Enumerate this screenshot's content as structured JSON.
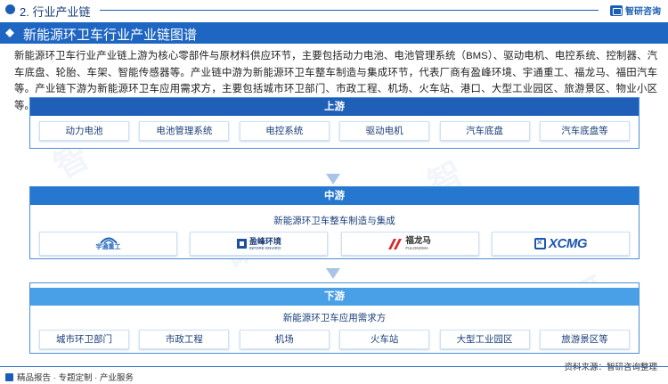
{
  "header": {
    "section": "2. 行业产业链",
    "brand": "智研咨询"
  },
  "title": "新能源环卫车行业产业链图谱",
  "paragraph": "新能源环卫车行业产业链上游为核心零部件与原材料供应环节，主要包括动力电池、电池管理系统（BMS）、驱动电机、电控系统、控制器、汽车底盘、轮胎、车架、智能传感器等。产业链中游为新能源环卫车整车制造与集成环节，代表厂商有盈峰环境、宇通重工、福龙马、福田汽车等。产业链下游为新能源环卫车应用需求方，主要包括城市环卫部门、市政工程、机场、火车站、港口、大型工业园区、旅游景区、物业小区等。",
  "upstream": {
    "heading": "上游",
    "items": [
      "动力电池",
      "电池管理系统",
      "电控系统",
      "驱动电机",
      "汽车底盘",
      "汽车底盘等"
    ]
  },
  "midstream": {
    "heading": "中游",
    "subtitle": "新能源环卫车整车制造与集成",
    "logos": {
      "yutong": "宇通重工",
      "infore_cn": "盈峰环境",
      "infore_en": "INFORE ENVIRO",
      "fulongma_cn": "福龙马",
      "fulongma_en": "FULONGMA",
      "xcmg": "XCMG"
    }
  },
  "downstream": {
    "heading": "下游",
    "subtitle": "新能源环卫车应用需求方",
    "items": [
      "城市环卫部门",
      "市政工程",
      "机场",
      "火车站",
      "大型工业园区",
      "旅游景区等"
    ]
  },
  "footer": {
    "left": "精品报告 · 专题定制 · 产业服务",
    "right": "资料来源：智研咨询整理"
  },
  "colors": {
    "primary": "#1f66c2",
    "upstream": "#1f5fb8",
    "midstream": "#2577cf",
    "downstream": "#4aa0e6"
  }
}
